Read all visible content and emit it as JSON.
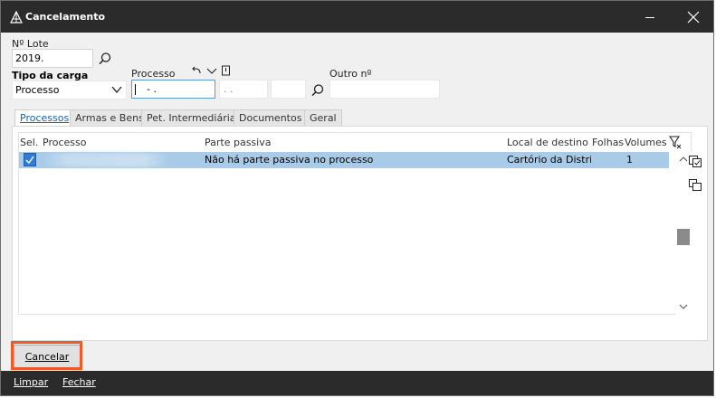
{
  "window": {
    "title": "Cancelamento"
  },
  "form": {
    "lote_label": "Nº Lote",
    "lote_value": "2019.",
    "tipo_label": "Tipo da carga",
    "tipo_value": "Processo",
    "processo_label": "Processo",
    "processo_part1": "- .",
    "processo_part2": ". .",
    "outro_label": "Outro nº",
    "outro_value": ""
  },
  "tabs": [
    {
      "label": "Processos"
    },
    {
      "label": "Armas e Bens"
    },
    {
      "label": "Pet. Intermediária"
    },
    {
      "label": "Documentos"
    },
    {
      "label": "Geral"
    }
  ],
  "grid": {
    "headers": {
      "sel": "Sel.",
      "processo": "Processo",
      "parte": "Parte passiva",
      "local": "Local de destino",
      "folhas": "Folhas",
      "volumes": "Volumes"
    },
    "rows": [
      {
        "selected": true,
        "processo": "",
        "parte": "Não há parte passiva no processo",
        "local": "Cartório da Distrit",
        "folhas": "",
        "volumes": "1"
      }
    ]
  },
  "buttons": {
    "cancelar": "Cancelar",
    "limpar": "Limpar",
    "fechar": "Fechar"
  },
  "colors": {
    "titlebar": "#2b2b2b",
    "selected_row": "#a9cbe8",
    "highlight": "#f05a28",
    "active_tab_text": "#1b5fb8"
  }
}
